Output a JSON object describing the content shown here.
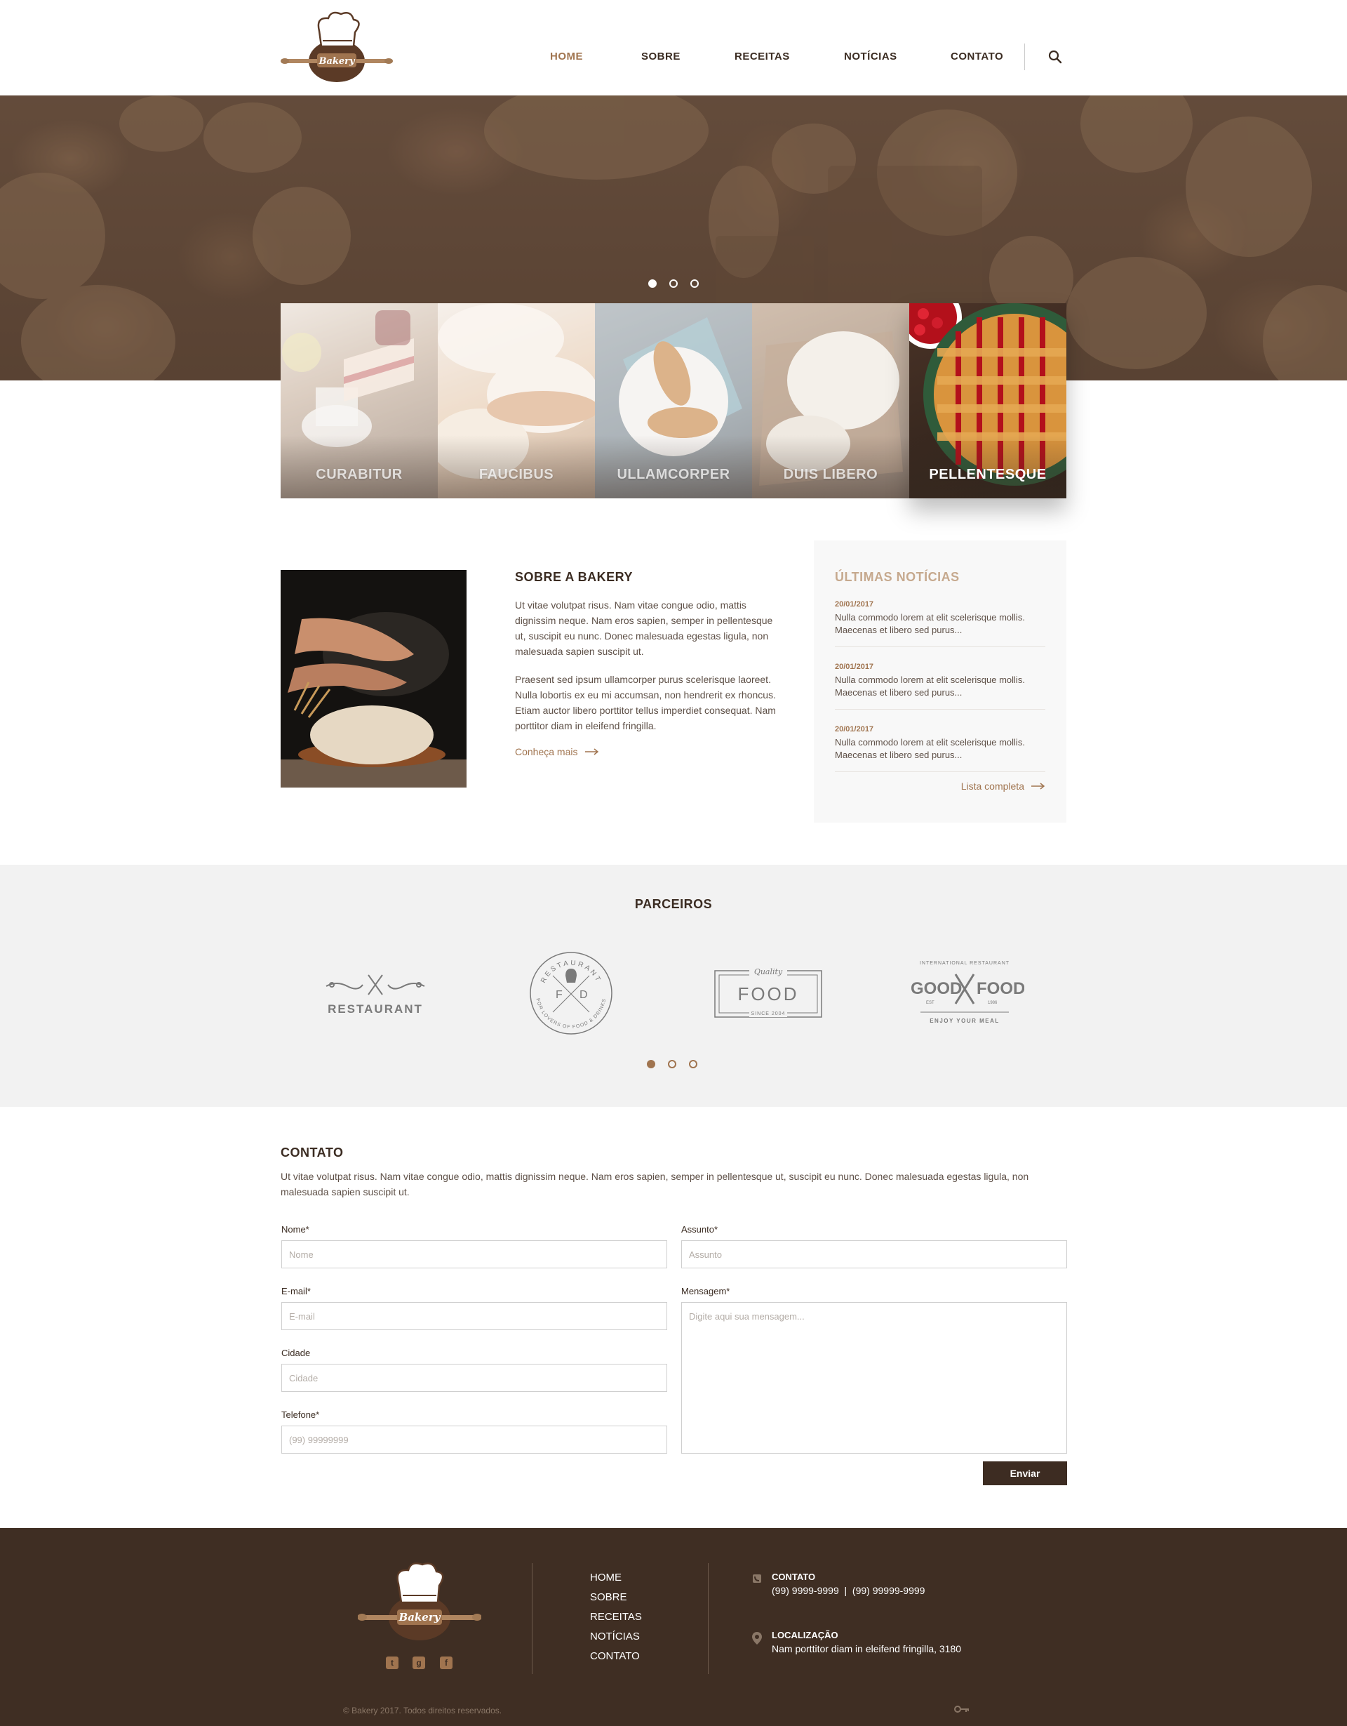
{
  "brand": {
    "name": "Bakery",
    "accent": "#a0744f",
    "dark": "#3f2e23"
  },
  "nav": {
    "items": [
      "HOME",
      "SOBRE",
      "RECEITAS",
      "NOTÍCIAS",
      "CONTATO"
    ],
    "active": "HOME",
    "search_icon": "search-icon"
  },
  "hero": {
    "slides": 3,
    "active_slide": 1
  },
  "categories": [
    {
      "label": "CURABITUR",
      "active": false
    },
    {
      "label": "FAUCIBUS",
      "active": false
    },
    {
      "label": "ULLAMCORPER",
      "active": false
    },
    {
      "label": "DUIS LIBERO",
      "active": false
    },
    {
      "label": "PELLENTESQUE",
      "active": true
    }
  ],
  "about": {
    "title": "SOBRE A BAKERY",
    "paragraph1": "Ut vitae volutpat risus. Nam vitae congue odio, mattis dignissim neque. Nam eros sapien, semper in pellentesque ut, suscipit eu nunc. Donec malesuada egestas ligula, non malesuada sapien suscipit ut.",
    "paragraph2": "Praesent sed ipsum ullamcorper purus scelerisque laoreet. Nulla lobortis ex eu mi accumsan, non hendrerit ex rhoncus. Etiam auctor libero porttitor tellus imperdiet consequat. Nam porttitor diam in eleifend fringilla.",
    "link": "Conheça mais"
  },
  "news": {
    "title": "ÚLTIMAS NOTÍCIAS",
    "items": [
      {
        "date": "20/01/2017",
        "text": "Nulla commodo lorem at elit scelerisque mollis. Maecenas et libero sed purus..."
      },
      {
        "date": "20/01/2017",
        "text": "Nulla commodo lorem at elit scelerisque mollis. Maecenas et libero sed purus..."
      },
      {
        "date": "20/01/2017",
        "text": "Nulla commodo lorem at elit scelerisque mollis. Maecenas et libero sed purus..."
      }
    ],
    "link": "Lista completa"
  },
  "partners": {
    "title": "PARCEIROS",
    "logos": [
      {
        "text": "RESTAURANT"
      },
      {
        "top": "RESTAURANT",
        "left": "F",
        "right": "D",
        "ring": "FOR LOVERS OF FOOD & DRINKS"
      },
      {
        "top": "Quality",
        "text": "FOOD",
        "bottom": "SINCE 2004"
      },
      {
        "top": "INTERNATIONAL RESTAURANT",
        "left": "GOOD",
        "right": "FOOD",
        "est": "EST",
        "year": "1986",
        "bottom": "ENJOY YOUR MEAL"
      }
    ],
    "slides": 3,
    "active_slide": 1
  },
  "contact": {
    "title": "CONTATO",
    "description": "Ut vitae volutpat risus. Nam vitae congue odio, mattis dignissim neque. Nam eros sapien, semper in pellentesque ut, suscipit eu nunc. Donec malesuada egestas ligula, non malesuada sapien suscipit ut.",
    "fields": {
      "nome": {
        "label": "Nome*",
        "placeholder": "Nome"
      },
      "email": {
        "label": "E-mail*",
        "placeholder": "E-mail"
      },
      "cidade": {
        "label": "Cidade",
        "placeholder": "Cidade"
      },
      "telefone": {
        "label": "Telefone*",
        "placeholder": "(99) 99999999"
      },
      "assunto": {
        "label": "Assunto*",
        "placeholder": "Assunto"
      },
      "mensagem": {
        "label": "Mensagem*",
        "placeholder": "Digite aqui sua mensagem..."
      }
    },
    "submit": "Enviar"
  },
  "footer": {
    "logo_text": "Bakery",
    "nav": [
      "HOME",
      "SOBRE",
      "RECEITAS",
      "NOTÍCIAS",
      "CONTATO"
    ],
    "contact_title": "CONTATO",
    "phones": "(99) 9999-9999  |  (99) 99999-9999",
    "location_title": "LOCALIZAÇÃO",
    "address": "Nam porttitor diam in eleifend fringilla, 3180",
    "social": [
      "twitter-icon",
      "google-plus-icon",
      "facebook-icon"
    ],
    "copyright": "© Bakery 2017. Todos direitos reservados."
  }
}
